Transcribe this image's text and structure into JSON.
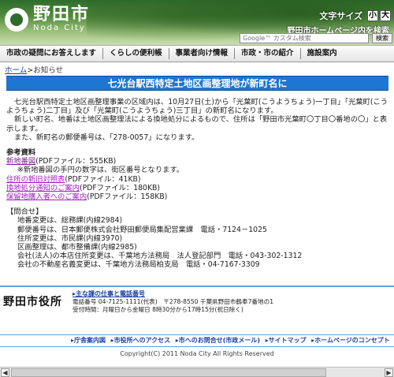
{
  "header": {
    "logo_ja": "野田市",
    "logo_en": "Noda City",
    "font_size_label": "文字サイズ",
    "font_small": "小",
    "font_large": "大",
    "home_link": "野田市ホームページ内を検索",
    "search_placeholder": "Google™ カスタム検索",
    "search_button": "検索"
  },
  "nav": {
    "items": [
      "市政の疑問にお答えします",
      "くらしの便利帳",
      "事業者向け情報",
      "市政・市の紹介",
      "施設案内"
    ]
  },
  "breadcrumb": {
    "home": "ホーム",
    "sep": ">",
    "current": "お知らせ"
  },
  "title": "七光台駅西特定土地区画整理地が新町名に",
  "body": {
    "p1": "七光台駅西特定土地区画整理事業の区域内は、10月27日(土)から「光葉町(こうようちょう)一丁目」「光葉町(こうようちょう)二丁目」及び「光葉町(こうようちょう)三丁目」の新町名になります。",
    "p2": "新しい町名、地番は土地区画整理法による換地処分によるもので、住所は「野田市光葉町〇丁目〇番地の〇」と表示します。",
    "p3": "また、新町名の郵便番号は、「278-0057」になります。",
    "ref_title": "参考資料",
    "ref1_link": "新地番図",
    "ref1_text": "(PDFファイル：555KB)",
    "ref1_note": "※新地番図の手円の数字は、街区番号となります。",
    "ref2_link": "住所の新旧対照表",
    "ref2_text": "(PDFファイル：41KB)",
    "ref3_link": "換地処分通知のご案内",
    "ref3_text": "(PDFファイル：180KB)",
    "ref4_link": "保留地購入者へのご案内",
    "ref4_text": "(PDFファイル：158KB)",
    "inq_title": "【問合せ】",
    "inq1": "地番変更は、総務課(内線2984)",
    "inq2": "郵便番号は、日本郵便株式会社野田郵便局集配営業課　電話・7124－1025",
    "inq3": "住所変更は、市民課(内線3970)",
    "inq4": "区画整理は、都市整備課(内線2985)",
    "inq5": "会社(法人)の本店住所変更は、千葉地方法務局　法人登記部門　電話・043-302-1312",
    "inq6": "会社の不動産名義変更は、千葉地方法務局柏支局　電話・04-7167-3309"
  },
  "footer": {
    "city_hall": "野田市役所",
    "main_link": "▸主な課の仕事と電話番号",
    "phone": "電話番号 04-7125-1111(代表)　〒278-8550 千葉県野田市鶴奉7番地の1",
    "hours": "受付時間：月曜日から金曜日 8時30分から17時15分(祝日除く)",
    "links": [
      "▸庁舎案内図",
      "▸市役所へのアクセス",
      "▸市へのお問合せ(市政メール)",
      "▸サイトマップ",
      "▸ホームページのコンセプト"
    ],
    "copyright": "Copyright(C) 2011 Noda City All Rights Reserved"
  }
}
